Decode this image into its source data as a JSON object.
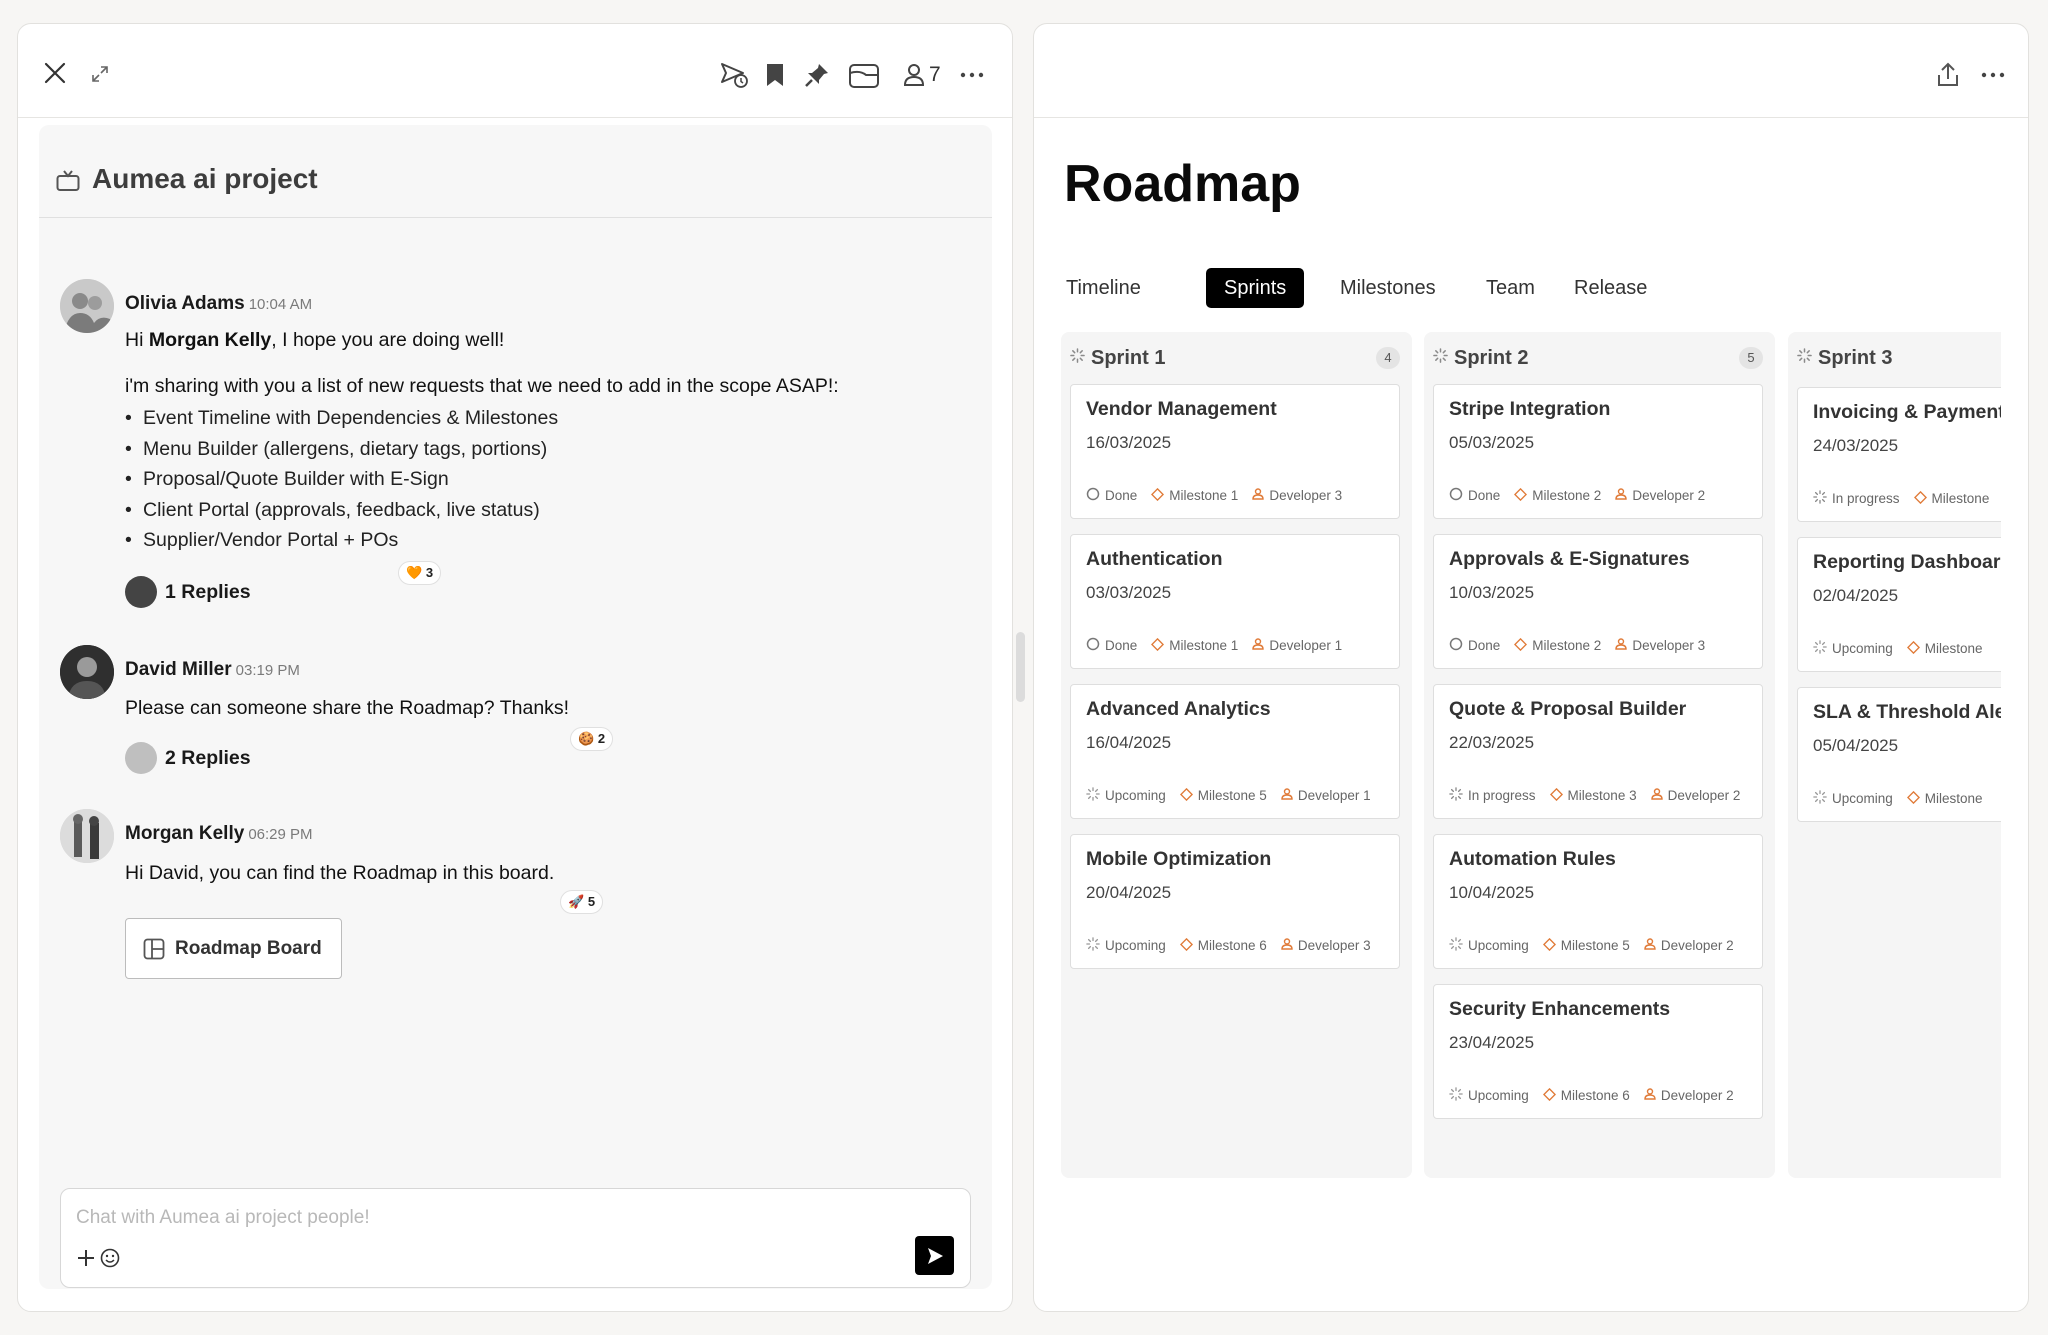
{
  "left": {
    "member_count": "7",
    "chat": {
      "title": "Aumea ai project",
      "composer_placeholder": "Chat with Aumea ai project people!",
      "messages": [
        {
          "author": "Olivia Adams",
          "time": "10:04 AM",
          "greeting_pre": "Hi ",
          "greeting_mention": "Morgan Kelly",
          "greeting_post": ", I hope you are doing well!",
          "intro": "i'm sharing with you a list of new requests that we need to add in the scope ASAP!:",
          "items": [
            "Event Timeline with Dependencies & Milestones",
            "Menu Builder (allergens, dietary tags, portions)",
            "Proposal/Quote Builder with E-Sign",
            "Client Portal (approvals, feedback, live status)",
            "Supplier/Vendor Portal + POs"
          ],
          "reaction_emoji": "🧡",
          "reaction_count": "3",
          "replies": "1 Replies"
        },
        {
          "author": "David Miller",
          "time": "03:19 PM",
          "text": "Please can someone share the Roadmap? Thanks!",
          "reaction_emoji": "🍪",
          "reaction_count": "2",
          "replies": "2 Replies"
        },
        {
          "author": "Morgan Kelly",
          "time": "06:29 PM",
          "text": "Hi David, you can find the Roadmap in this board.",
          "reaction_emoji": "🚀",
          "reaction_count": "5",
          "attachment": "Roadmap Board"
        }
      ]
    }
  },
  "right": {
    "title": "Roadmap",
    "tabs": [
      "Timeline",
      "Sprints",
      "Milestones",
      "Team",
      "Release"
    ],
    "active_tab": "Sprints",
    "sprints": [
      {
        "name": "Sprint 1",
        "count": "4",
        "cards": [
          {
            "title": "Vendor Management",
            "date": "16/03/2025",
            "status": "Done",
            "milestone": "Milestone 1",
            "developer": "Developer 3"
          },
          {
            "title": "Authentication",
            "date": "03/03/2025",
            "status": "Done",
            "milestone": "Milestone 1",
            "developer": "Developer 1"
          },
          {
            "title": "Advanced Analytics",
            "date": "16/04/2025",
            "status": "Upcoming",
            "milestone": "Milestone 5",
            "developer": "Developer 1"
          },
          {
            "title": "Mobile Optimization",
            "date": "20/04/2025",
            "status": "Upcoming",
            "milestone": "Milestone 6",
            "developer": "Developer 3"
          }
        ]
      },
      {
        "name": "Sprint 2",
        "count": "5",
        "cards": [
          {
            "title": "Stripe Integration",
            "date": "05/03/2025",
            "status": "Done",
            "milestone": "Milestone 2",
            "developer": "Developer 2"
          },
          {
            "title": "Approvals & E-Signatures",
            "date": "10/03/2025",
            "status": "Done",
            "milestone": "Milestone 2",
            "developer": "Developer 3"
          },
          {
            "title": "Quote & Proposal Builder",
            "date": "22/03/2025",
            "status": "In progress",
            "milestone": "Milestone 3",
            "developer": "Developer 2"
          },
          {
            "title": "Automation Rules",
            "date": "10/04/2025",
            "status": "Upcoming",
            "milestone": "Milestone 5",
            "developer": "Developer 2"
          },
          {
            "title": "Security Enhancements",
            "date": "23/04/2025",
            "status": "Upcoming",
            "milestone": "Milestone 6",
            "developer": "Developer 2"
          }
        ]
      },
      {
        "name": "Sprint 3",
        "count": "",
        "cards": [
          {
            "title": "Invoicing & Payment",
            "date": "24/03/2025",
            "status": "In progress",
            "milestone": "Milestone",
            "developer": ""
          },
          {
            "title": "Reporting Dashboard",
            "date": "02/04/2025",
            "status": "Upcoming",
            "milestone": "Milestone",
            "developer": ""
          },
          {
            "title": "SLA & Threshold Alerts",
            "date": "05/04/2025",
            "status": "Upcoming",
            "milestone": "Milestone",
            "developer": ""
          }
        ]
      }
    ]
  },
  "colors": {
    "accent": "#e07b39",
    "done": "#666666",
    "active_tab_bg": "#000000"
  }
}
